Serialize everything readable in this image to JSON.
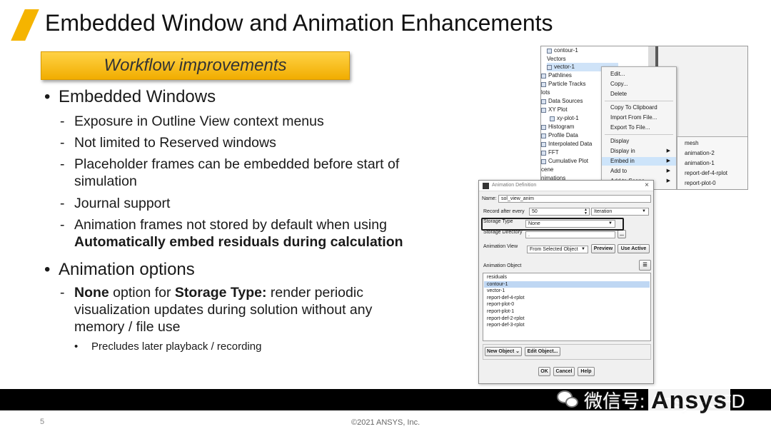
{
  "slide": {
    "title": "Embedded Window and Animation Enhancements",
    "badge": "Workflow improvements",
    "bullets": [
      {
        "text": "Embedded Windows",
        "subs": [
          "Exposure in Outline View context menus",
          "Not limited to Reserved windows",
          "Placeholder frames can be embedded before start of simulation",
          "Journal support",
          "Animation frames not stored by default when using"
        ],
        "sub5_bold": "Automatically embed residuals during calculation"
      },
      {
        "text": "Animation options",
        "sub1_bold_a": "None",
        "sub1_mid": " option for ",
        "sub1_bold_b": "Storage Type:",
        "sub1_rest": " render periodic visualization updates during solution without any memory / file use",
        "sub_sub": "Precludes later playback / recording"
      }
    ]
  },
  "outline_tree": {
    "items": [
      "contour-1",
      "Vectors",
      "vector-1",
      "Pathlines",
      "Particle Tracks",
      "lots",
      "Data Sources",
      "XY Plot",
      "xy-plot-1",
      "Histogram",
      "Profile Data",
      "Interpolated Data",
      "FFT",
      "Cumulative Plot",
      "cene",
      "nimations"
    ]
  },
  "context_menu": {
    "items": [
      "Edit...",
      "Copy...",
      "Delete",
      "Copy To Clipboard",
      "Import From File...",
      "Export To File...",
      "Display",
      "Display in",
      "Embed in",
      "Add to",
      "Add to Scene"
    ],
    "submenu": [
      "mesh",
      "animation-2",
      "animation-1",
      "report-def-4-rplot",
      "report-plot-0",
      "report-plot-1"
    ]
  },
  "animation_dialog": {
    "title": "Animation Definition",
    "name_label": "Name",
    "name_value": "sol_view_anim",
    "record_label": "Record after every",
    "record_value": "50",
    "record_unit": "Iteration",
    "storage_type_label": "Storage Type",
    "storage_type_value": "None",
    "storage_dir_label": "Storage Directory",
    "storage_dir_value": ".",
    "browse": "...",
    "animation_view_label": "Animation View",
    "animation_view_value": "From Selected Object",
    "preview_btn": "Preview",
    "use_active_btn": "Use Active",
    "animation_object_label": "Animation Object",
    "objects": [
      "residuals",
      "contour-1",
      "vector-1",
      "report-def-4-rplot",
      "report-plot-0",
      "report-plot-1",
      "report-def-2-rplot",
      "report-def-3-rplot"
    ],
    "selected_object": "contour-1",
    "new_object_btn": "New Object",
    "edit_object_btn": "Edit Object...",
    "ok_btn": "OK",
    "cancel_btn": "Cancel",
    "help_btn": "Help"
  },
  "footer": {
    "page_number": "5",
    "copyright": "©2021 ANSYS, Inc.",
    "wechat_text": "微信号: Ansys-CFD",
    "logo": "Ansys"
  }
}
